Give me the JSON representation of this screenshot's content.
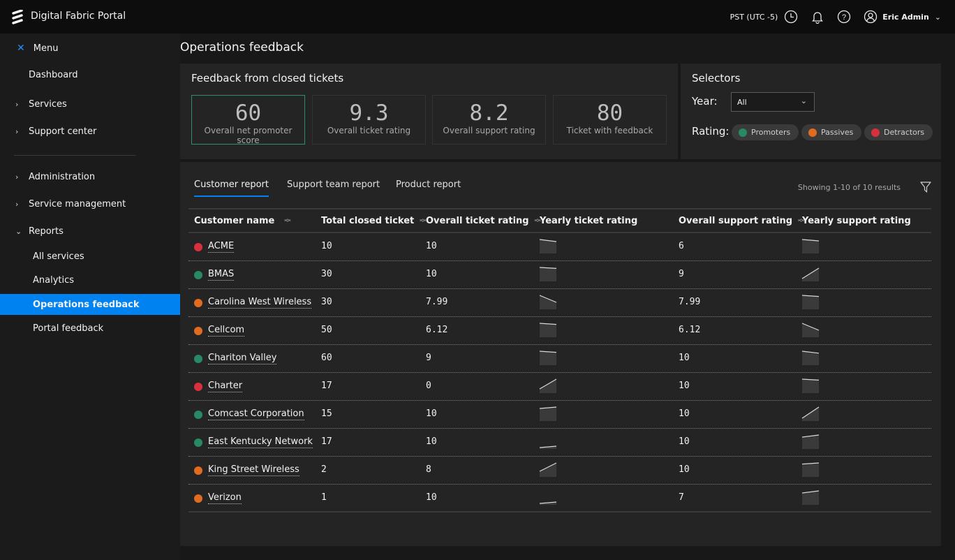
{
  "app": {
    "title": "Digital Fabric Portal",
    "timezone": "PST (UTC -5)",
    "user": "Eric Admin"
  },
  "sidebar": {
    "menu_label": "Menu",
    "items": [
      {
        "label": "Dashboard",
        "chevron": ""
      },
      {
        "label": "Services",
        "chevron": "›"
      },
      {
        "label": "Support center",
        "chevron": "›"
      },
      {
        "label": "Administration",
        "chevron": "›"
      },
      {
        "label": "Service management",
        "chevron": "›"
      },
      {
        "label": "Reports",
        "chevron": "⌄"
      }
    ],
    "sub_items": [
      {
        "label": "All services"
      },
      {
        "label": "Analytics"
      },
      {
        "label": "Operations feedback",
        "active": true
      },
      {
        "label": "Portal feedback"
      }
    ]
  },
  "page": {
    "title": "Operations feedback"
  },
  "feedback": {
    "title": "Feedback from closed tickets",
    "kpis": [
      {
        "value": "60",
        "label": "Overall net promoter score",
        "selected": true
      },
      {
        "value": "9.3",
        "label": "Overall ticket rating"
      },
      {
        "value": "8.2",
        "label": "Overall support rating"
      },
      {
        "value": "80",
        "label": "Ticket with feedback"
      }
    ]
  },
  "selectors": {
    "title": "Selectors",
    "year_label": "Year:",
    "year_value": "All",
    "rating_label": "Rating:",
    "ratings": [
      {
        "label": "Promoters",
        "color": "#288964"
      },
      {
        "label": "Passives",
        "color": "#e06c1f"
      },
      {
        "label": "Detractors",
        "color": "#d9303d"
      }
    ]
  },
  "report": {
    "tabs": [
      {
        "label": "Customer report",
        "active": true
      },
      {
        "label": "Support team report"
      },
      {
        "label": "Product report"
      }
    ],
    "showing": "Showing 1-10 of 10 results",
    "columns": [
      {
        "label": "Customer name",
        "sortable": true
      },
      {
        "label": "Total closed ticket",
        "sortable": true
      },
      {
        "label": "Overall ticket rating",
        "sortable": true
      },
      {
        "label": "Yearly ticket rating",
        "sortable": false
      },
      {
        "label": "Overall support rating",
        "sortable": true
      },
      {
        "label": "Yearly support rating",
        "sortable": false
      }
    ],
    "status_colors": {
      "promoter": "#288964",
      "passive": "#e06c1f",
      "detractor": "#d9303d"
    },
    "rows": [
      {
        "name": "ACME",
        "status": "detractor",
        "total": "10",
        "ticket_rating": "10",
        "ticket_trend": [
          10,
          8.5
        ],
        "support_rating": "6",
        "support_trend": [
          10,
          9
        ]
      },
      {
        "name": "BMAS",
        "status": "promoter",
        "total": "30",
        "ticket_rating": "10",
        "ticket_trend": [
          10,
          9.3
        ],
        "support_rating": "9",
        "support_trend": [
          2,
          9.5
        ]
      },
      {
        "name": "Carolina West Wireless",
        "status": "passive",
        "total": "30",
        "ticket_rating": "7.99",
        "ticket_trend": [
          10,
          5
        ],
        "support_rating": "7.99",
        "support_trend": [
          10,
          9.2
        ]
      },
      {
        "name": "Cellcom",
        "status": "passive",
        "total": "50",
        "ticket_rating": "6.12",
        "ticket_trend": [
          10,
          9.2
        ],
        "support_rating": "6.12",
        "support_trend": [
          10,
          5
        ]
      },
      {
        "name": "Chariton Valley",
        "status": "promoter",
        "total": "60",
        "ticket_rating": "9",
        "ticket_trend": [
          10,
          9.2
        ],
        "support_rating": "10",
        "support_trend": [
          10,
          8.6
        ]
      },
      {
        "name": "Charter",
        "status": "detractor",
        "total": "17",
        "ticket_rating": "0",
        "ticket_trend": [
          3,
          10
        ],
        "support_rating": "10",
        "support_trend": [
          10,
          9.3
        ]
      },
      {
        "name": "Comcast Corporation",
        "status": "promoter",
        "total": "15",
        "ticket_rating": "10",
        "ticket_trend": [
          9,
          10
        ],
        "support_rating": "10",
        "support_trend": [
          2,
          10
        ]
      },
      {
        "name": "East Kentucky Network",
        "status": "promoter",
        "total": "17",
        "ticket_rating": "10",
        "ticket_trend": [
          1,
          2
        ],
        "support_rating": "10",
        "support_trend": [
          8.5,
          10
        ]
      },
      {
        "name": "King Street Wireless",
        "status": "passive",
        "total": "2",
        "ticket_rating": "8",
        "ticket_trend": [
          4,
          10
        ],
        "support_rating": "10",
        "support_trend": [
          9.2,
          10
        ]
      },
      {
        "name": "Verizon",
        "status": "passive",
        "total": "1",
        "ticket_rating": "10",
        "ticket_trend": [
          1,
          2
        ],
        "support_rating": "7",
        "support_trend": [
          8.5,
          10
        ]
      }
    ]
  }
}
